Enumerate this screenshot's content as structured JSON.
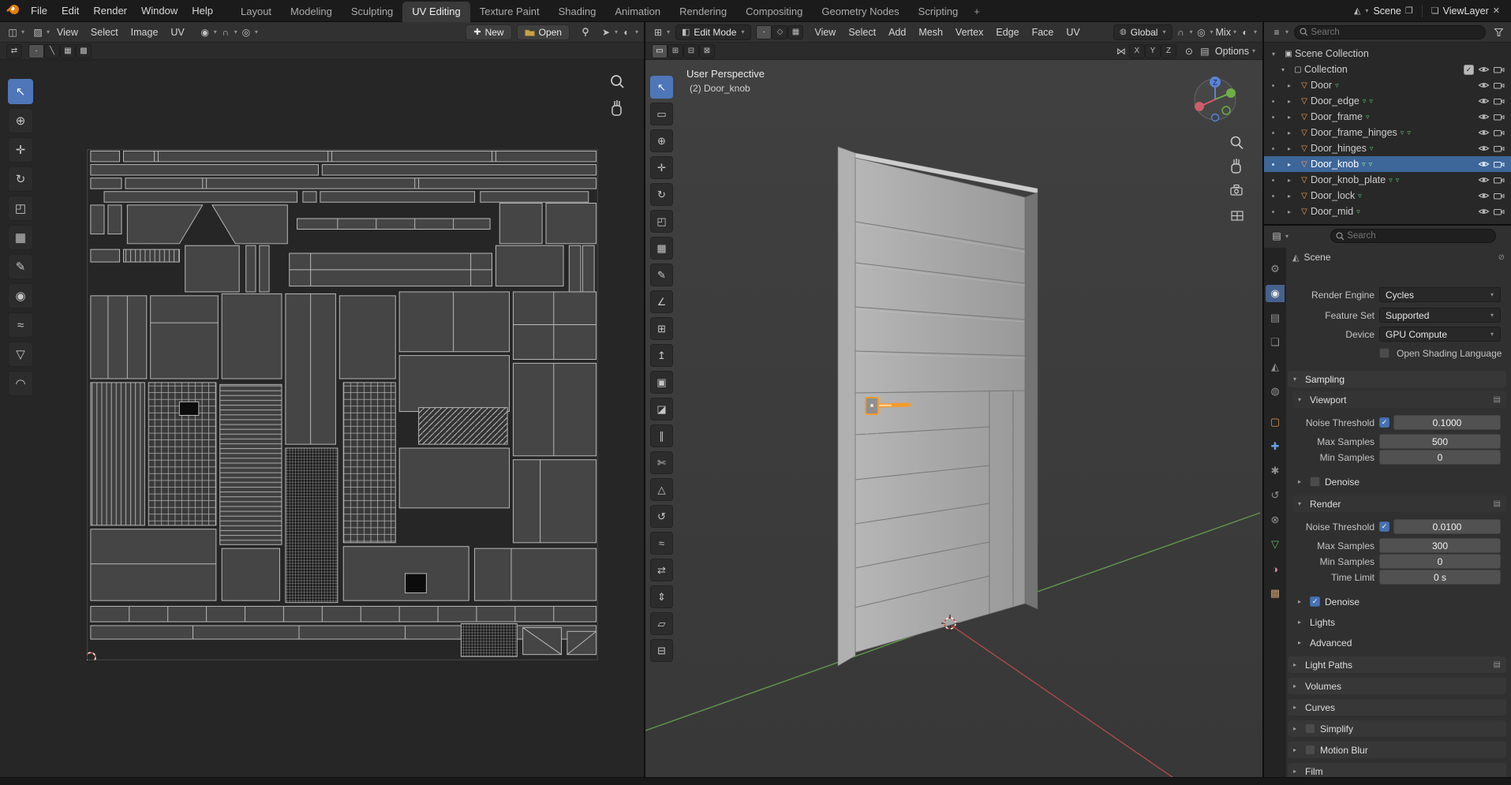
{
  "topbar": {
    "app_menus": [
      "File",
      "Edit",
      "Render",
      "Window",
      "Help"
    ],
    "workspaces": [
      "Layout",
      "Modeling",
      "Sculpting",
      "UV Editing",
      "Texture Paint",
      "Shading",
      "Animation",
      "Rendering",
      "Compositing",
      "Geometry Nodes",
      "Scripting"
    ],
    "active_workspace": "UV Editing",
    "add_workspace": "+",
    "scene": {
      "label": "Scene"
    },
    "view_layer": {
      "label": "ViewLayer"
    }
  },
  "uv_editor": {
    "menus": [
      "View",
      "Select",
      "Image",
      "UV"
    ],
    "new_button": "New",
    "open_button": "Open",
    "tools": [
      {
        "name": "tweak",
        "glyph": "↖"
      },
      {
        "name": "cursor-2d",
        "glyph": "⊕"
      },
      {
        "name": "move",
        "glyph": "✛"
      },
      {
        "name": "rotate",
        "glyph": "↻"
      },
      {
        "name": "scale",
        "glyph": "◰"
      },
      {
        "name": "transform",
        "glyph": "▦"
      },
      {
        "name": "annotate",
        "glyph": "✎"
      },
      {
        "name": "grab",
        "glyph": "◉"
      },
      {
        "name": "relax",
        "glyph": "≈"
      },
      {
        "name": "pinch",
        "glyph": "▽"
      },
      {
        "name": "smooth",
        "glyph": "◠"
      }
    ]
  },
  "viewport": {
    "mode": "Edit Mode",
    "menus": [
      "View",
      "Select",
      "Add",
      "Mesh",
      "Vertex",
      "Edge",
      "Face",
      "UV"
    ],
    "orientation": "Global",
    "falloff": "Mix",
    "options_label": "Options",
    "mirror_axes": [
      "X",
      "Y",
      "Z"
    ],
    "overlay": {
      "perspective": "User Perspective",
      "active_object": "(2) Door_knob"
    },
    "gizmo_axis": "Z",
    "tools": [
      {
        "name": "tweak",
        "glyph": "↖"
      },
      {
        "name": "select-box",
        "glyph": "▭"
      },
      {
        "name": "cursor",
        "glyph": "⊕"
      },
      {
        "name": "move",
        "glyph": "✛"
      },
      {
        "name": "rotate",
        "glyph": "↻"
      },
      {
        "name": "scale",
        "glyph": "◰"
      },
      {
        "name": "transform",
        "glyph": "▦"
      },
      {
        "name": "annotate",
        "glyph": "✎"
      },
      {
        "name": "measure",
        "glyph": "∠"
      },
      {
        "name": "add-cube",
        "glyph": "⊞"
      },
      {
        "name": "extrude-region",
        "glyph": "↥"
      },
      {
        "name": "inset-faces",
        "glyph": "▣"
      },
      {
        "name": "bevel",
        "glyph": "◪"
      },
      {
        "name": "loop-cut",
        "glyph": "∥"
      },
      {
        "name": "knife",
        "glyph": "✄"
      },
      {
        "name": "poly-build",
        "glyph": "△"
      },
      {
        "name": "spin",
        "glyph": "↺"
      },
      {
        "name": "smooth",
        "glyph": "≈"
      },
      {
        "name": "edge-slide",
        "glyph": "⇄"
      },
      {
        "name": "shrink-fatten",
        "glyph": "⇕"
      },
      {
        "name": "shear",
        "glyph": "▱"
      },
      {
        "name": "rip-region",
        "glyph": "⊟"
      }
    ]
  },
  "outliner": {
    "search_placeholder": "Search",
    "scene_collection": "Scene Collection",
    "collection": "Collection",
    "items": [
      {
        "name": "Door",
        "selected": false
      },
      {
        "name": "Door_edge",
        "selected": false
      },
      {
        "name": "Door_frame",
        "selected": false
      },
      {
        "name": "Door_frame_hinges",
        "selected": false
      },
      {
        "name": "Door_hinges",
        "selected": false
      },
      {
        "name": "Door_knob",
        "selected": true
      },
      {
        "name": "Door_knob_plate",
        "selected": false
      },
      {
        "name": "Door_lock",
        "selected": false
      },
      {
        "name": "Door_mid",
        "selected": false
      }
    ]
  },
  "properties": {
    "search_placeholder": "Search",
    "breadcrumb": "Scene",
    "render_engine": {
      "label": "Render Engine",
      "value": "Cycles"
    },
    "feature_set": {
      "label": "Feature Set",
      "value": "Supported"
    },
    "device": {
      "label": "Device",
      "value": "GPU Compute"
    },
    "osl": {
      "label": "Open Shading Language",
      "checked": false
    },
    "sampling": {
      "title": "Sampling",
      "viewport": {
        "title": "Viewport",
        "noise_threshold": {
          "label": "Noise Threshold",
          "value": "0.1000",
          "checked": true
        },
        "max_samples": {
          "label": "Max Samples",
          "value": "500"
        },
        "min_samples": {
          "label": "Min Samples",
          "value": "0"
        },
        "denoise": {
          "label": "Denoise",
          "checked": false
        }
      },
      "render": {
        "title": "Render",
        "noise_threshold": {
          "label": "Noise Threshold",
          "value": "0.0100",
          "checked": true
        },
        "max_samples": {
          "label": "Max Samples",
          "value": "300"
        },
        "min_samples": {
          "label": "Min Samples",
          "value": "0"
        },
        "time_limit": {
          "label": "Time Limit",
          "value": "0 s"
        },
        "denoise": {
          "label": "Denoise",
          "checked": true
        }
      },
      "lights": "Lights",
      "advanced": "Advanced"
    },
    "panels": {
      "light_paths": "Light Paths",
      "volumes": "Volumes",
      "curves": "Curves",
      "simplify": {
        "label": "Simplify",
        "checked": false
      },
      "motion_blur": {
        "label": "Motion Blur",
        "checked": false
      },
      "film": "Film"
    }
  }
}
